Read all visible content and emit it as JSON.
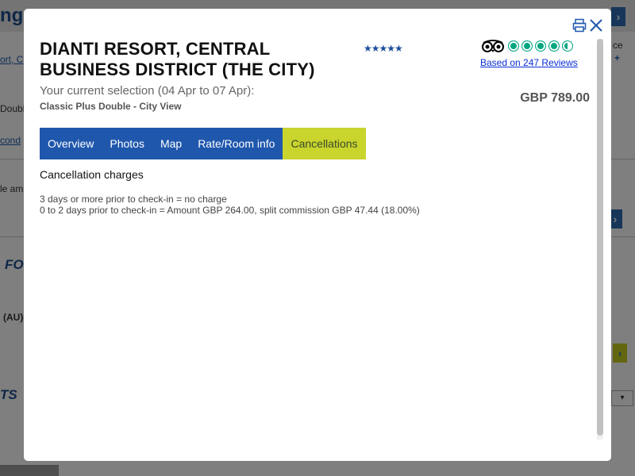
{
  "background": {
    "header_fragment": "ng",
    "link_1": "ort, C",
    "text_double": "Double",
    "link_2": "cond",
    "text_amenities": "le am",
    "text_ce": "ce",
    "bold_fo": "FO",
    "text_au": "(AU)",
    "bold_ts": "TS",
    "select_value": "▾",
    "arrow_glyph": "›",
    "plus_glyph": "+"
  },
  "modal": {
    "title": "DIANTI RESORT, CENTRAL BUSINESS DISTRICT (THE CITY)",
    "stars": "★★★★★",
    "tripadvisor": {
      "rating": 4.5,
      "rating_max": 5,
      "reviews_link": "Based on 247 Reviews"
    },
    "selection_text": "Your current selection (04 Apr to 07 Apr):",
    "room_name": "Classic Plus Double - City View",
    "price": "GBP 789.00",
    "tabs": [
      {
        "label": "Overview",
        "active": false
      },
      {
        "label": "Photos",
        "active": false
      },
      {
        "label": "Map",
        "active": false
      },
      {
        "label": "Rate/Room info",
        "active": false
      },
      {
        "label": "Cancellations",
        "active": true
      }
    ],
    "section_title": "Cancellation charges",
    "charges": [
      "3 days or more prior to check-in = no charge",
      "0 to 2 days prior to check-in = Amount GBP 264.00, split commission GBP 47.44 (18.00%)"
    ],
    "icons": {
      "print": "print-icon",
      "close": "close-icon",
      "tripadvisor": "tripadvisor-owl-icon"
    },
    "colors": {
      "tab_bg": "#1f57ad",
      "tab_active_bg": "#c9d42d",
      "rating_green": "#00a680",
      "link": "#0a2fd6"
    }
  }
}
